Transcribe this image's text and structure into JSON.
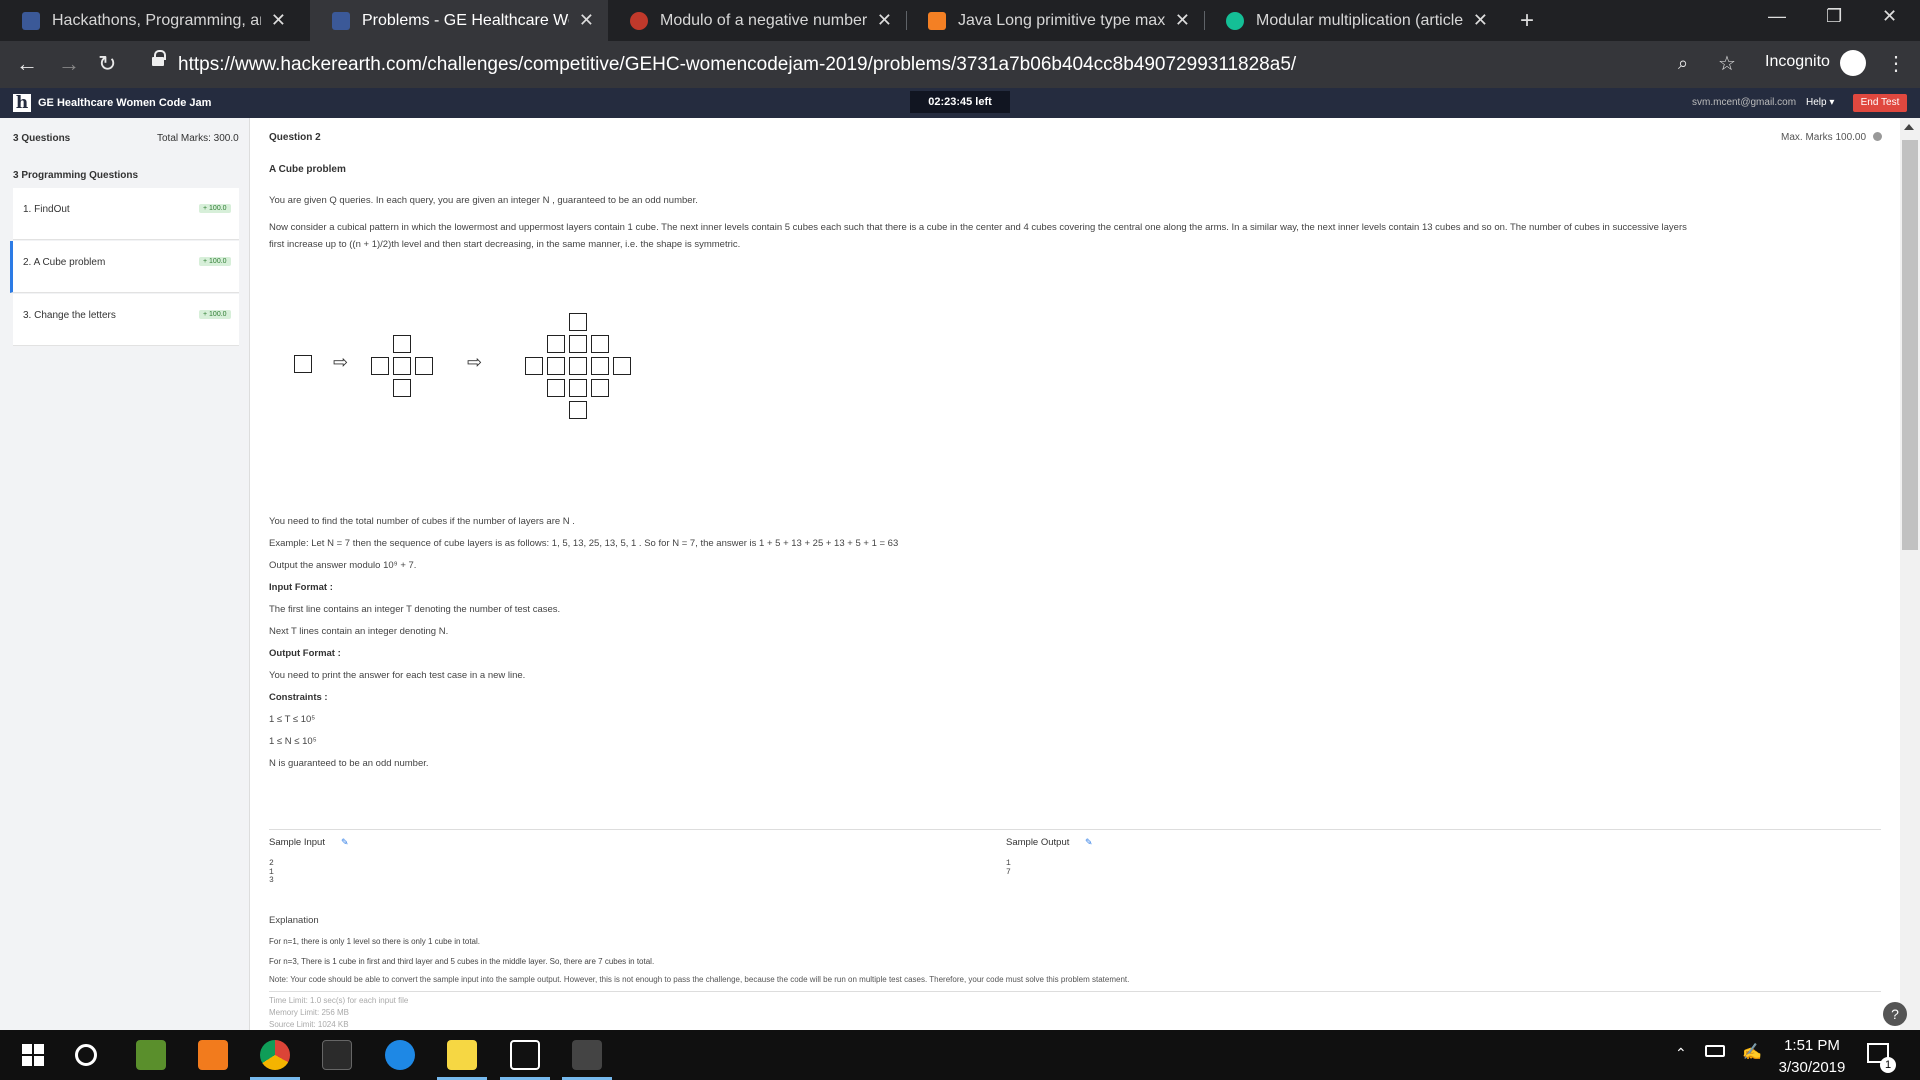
{
  "browser": {
    "tabs": [
      {
        "title": "Hackathons, Programming, and C",
        "favicon": "hackerearth-icon",
        "color": "#3b5998"
      },
      {
        "title": "Problems - GE Healthcare Wome",
        "favicon": "hackerearth-icon",
        "color": "#3b5998"
      },
      {
        "title": "Modulo of a negative number - M",
        "favicon": "quora-icon",
        "color": "#c0392b"
      },
      {
        "title": "Java Long primitive type maximu",
        "favicon": "stackoverflow-icon",
        "color": "#f48024"
      },
      {
        "title": "Modular multiplication (article) | ",
        "favicon": "khan-academy-icon",
        "color": "#14bf96"
      }
    ],
    "url": "https://www.hackerearth.com/challenges/competitive/GEHC-womencodejam-2019/problems/3731a7b06b404cc8b4907299311828a5/",
    "mode_label": "Incognito"
  },
  "site": {
    "title": "GE Healthcare Women Code Jam",
    "timer": "02:23:45 left",
    "email": "svm.mcent@gmail.com",
    "help": "Help ▾",
    "end_test": "End Test"
  },
  "sidebar": {
    "questions_count": "3 Questions",
    "total_marks": "Total Marks: 300.0",
    "section_label": "3 Programming Questions",
    "items": [
      {
        "label": "1. FindOut",
        "badge": "+ 100.0"
      },
      {
        "label": "2. A Cube problem",
        "badge": "+ 100.0"
      },
      {
        "label": "3. Change the letters",
        "badge": "+ 100.0"
      }
    ]
  },
  "problem": {
    "question_number": "Question  2",
    "max_marks": "Max. Marks 100.00",
    "title": "A Cube problem",
    "intro": " You are given Q queries. In each query, you are given an integer N , guaranteed to be an odd number.",
    "pattern_line1": "Now consider a cubical pattern in which the lowermost and uppermost layers contain 1 cube. The next inner levels contain 5 cubes each such that there is a cube in the center and 4 cubes covering the central one along the arms. In a similar way, the next inner levels contain 13  cubes and so on. The number of cubes in successive layers",
    "pattern_line2": "first increase up to ((n + 1)/2)th level and then start decreasing, in the same manner, i.e. the shape is symmetric.",
    "task": "You need to find the total number of cubes if the number of layers are N .",
    "example": "Example: Let N = 7 then the sequence of cube layers is as follows: 1, 5, 13, 25, 13, 5, 1 . So for N = 7, the answer is 1 + 5 + 13 + 25 + 13 + 5 + 1 = 63",
    "modulo": "Output the answer modulo 10⁹ + 7.",
    "input_format_label": "Input Format :",
    "input_line1": "The first line contains an integer T denoting the number of test cases.",
    "input_line2": "Next T lines contain an integer denoting N.",
    "output_format_label": "Output Format :",
    "output_line": "You need to print the answer for each test case in a new line.",
    "constraints_label": "Constraints :",
    "constraint1": "1 ≤ T ≤ 10⁵",
    "constraint2": "1 ≤ N ≤ 10⁵",
    "constraint3": "N is guaranteed to be an odd number.",
    "sample_input_label": "Sample Input",
    "sample_input": "2\n1\n3",
    "sample_output_label": "Sample Output",
    "sample_output": "1\n7",
    "explanation_label": "Explanation",
    "explanation1": "For n=1, there is only 1 level so there is only 1 cube in total.",
    "explanation2": "For n=3, There is 1 cube in first and third layer and 5 cubes in the middle layer. So, there are 7 cubes in total.",
    "note": "Note: Your code should be able to convert the sample input into the sample output. However, this is not enough to pass the challenge, because the code will be run on multiple test cases. Therefore, your code must solve this problem statement.",
    "time_limit": "Time Limit: 1.0 sec(s) for each input file",
    "memory_limit": "Memory Limit: 256 MB",
    "source_limit": "Source Limit: 1024 KB"
  },
  "taskbar": {
    "time": "1:51 PM",
    "date": "3/30/2019",
    "notification_count": "1"
  }
}
